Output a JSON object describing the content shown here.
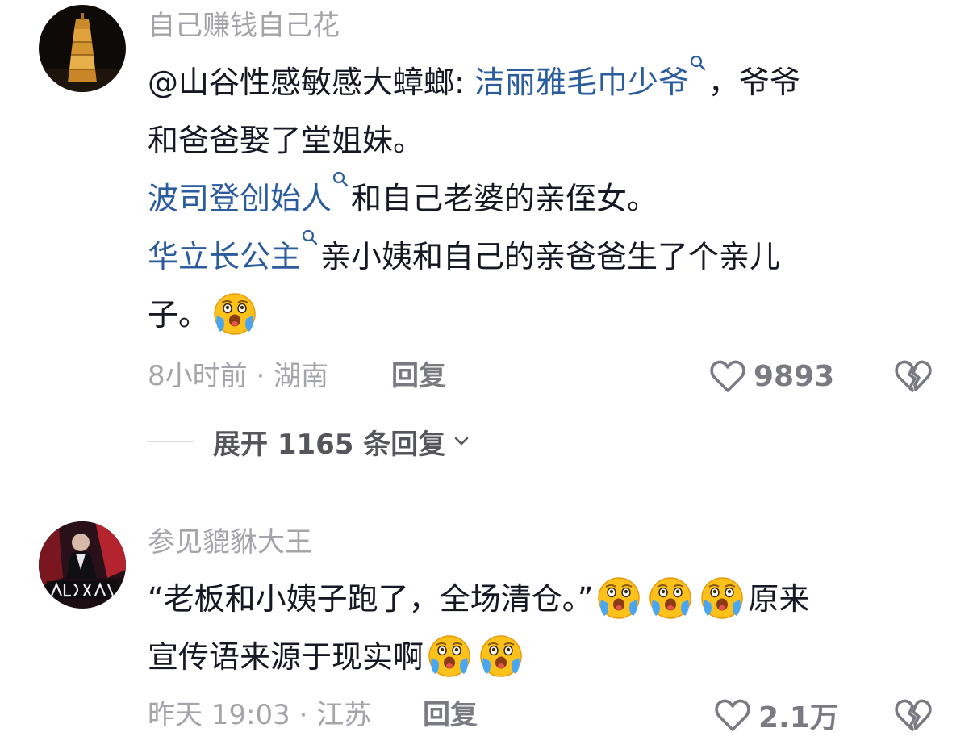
{
  "comments": [
    {
      "username": "自己赚钱自己花",
      "mention": "@山谷性感敏感大蟑螂: ",
      "link1": "洁丽雅毛巾少爷",
      "line1_tail": "，爷爷",
      "line2": "和爸爸娶了堂姐妹。",
      "link2": "波司登创始人",
      "line3_tail": "和自己老婆的亲侄女。",
      "link3": "华立长公主",
      "line4_tail": "亲小姨和自己的亲爸爸生了个亲儿",
      "line5": "子。",
      "time": "8小时前 · 湖南",
      "reply": "回复",
      "likes": "9893",
      "expand": "展开 1165 条回复"
    },
    {
      "username": "参见貔貅大王",
      "line1": "“老板和小姨子跑了，全场清仓。”",
      "line1_tail": "原来",
      "line2": "宣传语来源于现实啊",
      "time": "昨天 19:03 · 江苏",
      "reply": "回复",
      "likes": "2.1万"
    }
  ],
  "icons": {
    "search": "search-small-icon",
    "emoji": "crying-face-emoji",
    "like": "heart-outline-icon",
    "dislike": "broken-heart-icon",
    "chevron": "chevron-down-icon"
  },
  "colors": {
    "link": "#2b5d9e",
    "secondary_text": "#a4a5ab",
    "action_text": "#7a7b82"
  }
}
